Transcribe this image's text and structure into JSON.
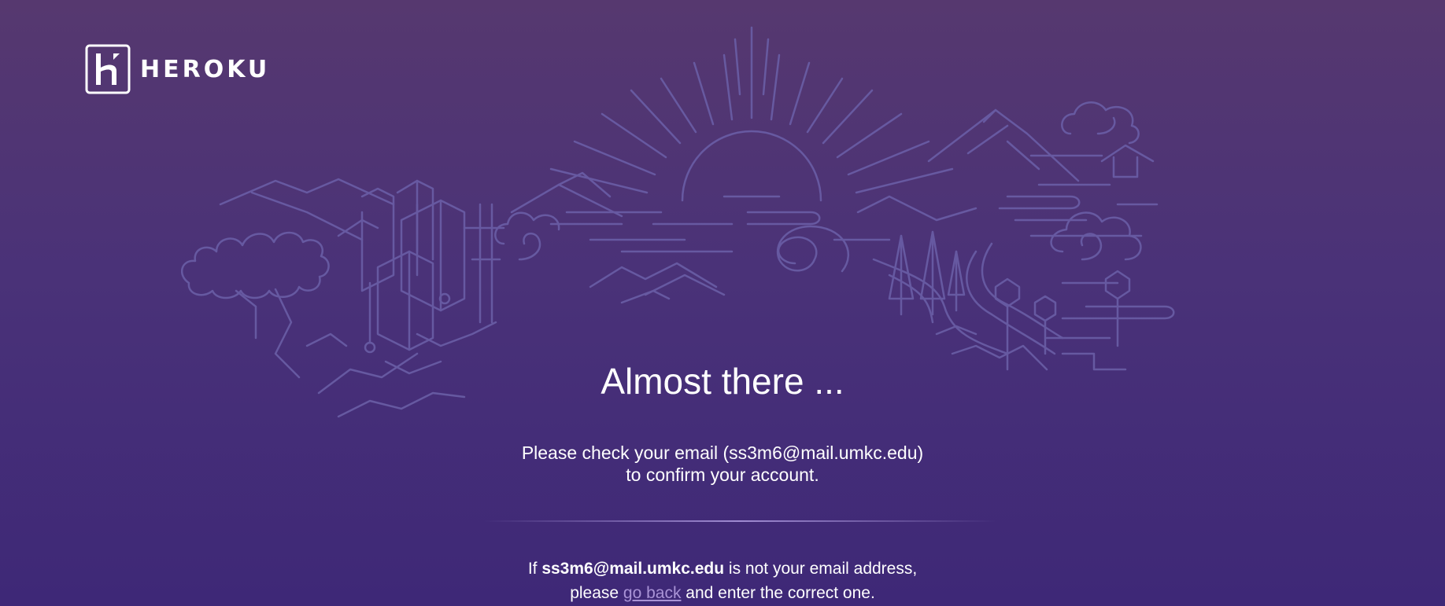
{
  "brand": {
    "name": "HEROKU"
  },
  "content": {
    "title": "Almost there ...",
    "message_line1": "Please check your email (ss3m6@mail.umkc.edu)",
    "message_line2": "to confirm your account.",
    "note_prefix": "If ",
    "note_email": "ss3m6@mail.umkc.edu",
    "note_suffix": " is not your email address,",
    "note_line2_prefix": "please ",
    "go_back_label": "go back",
    "note_line2_suffix": " and enter the correct one."
  },
  "colors": {
    "background_top": "#56386f",
    "background_bottom": "#3e2877",
    "illustration_stroke": "#6a5ea6",
    "link": "#a993d6"
  },
  "icons": [
    "heroku-logo-icon",
    "landscape-illustration"
  ]
}
